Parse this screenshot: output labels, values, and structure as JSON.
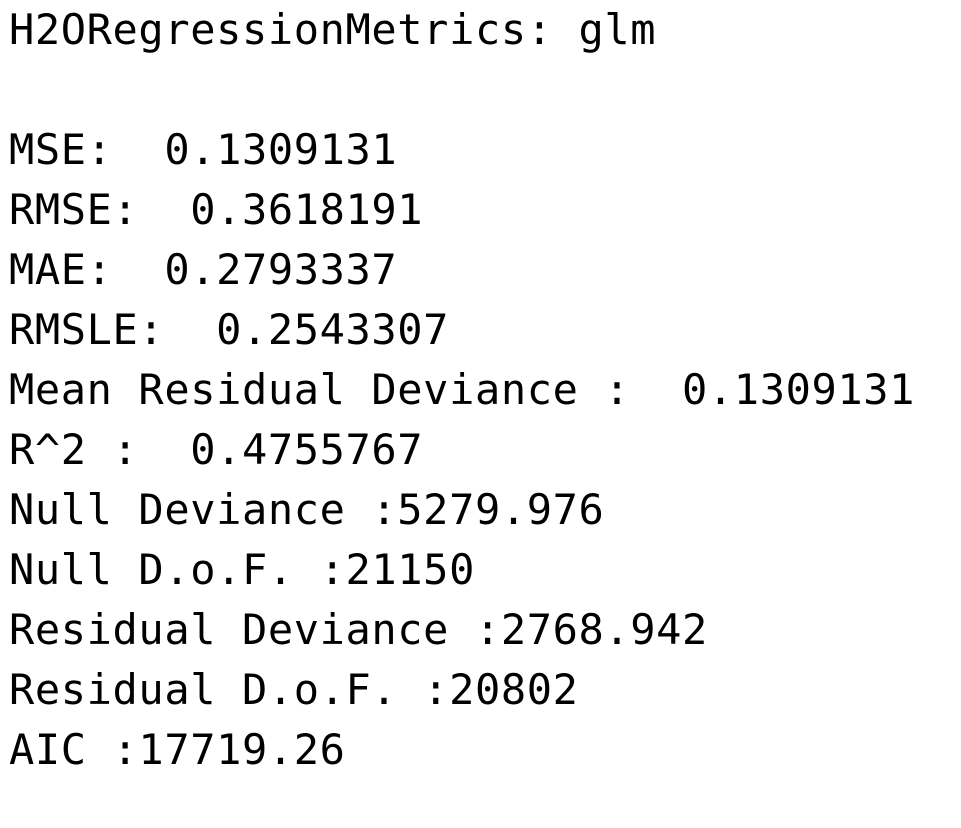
{
  "header": "H2ORegressionMetrics: glm",
  "metrics": [
    "MSE:  0.1309131",
    "RMSE:  0.3618191",
    "MAE:  0.2793337",
    "RMSLE:  0.2543307",
    "Mean Residual Deviance :  0.1309131",
    "R^2 :  0.4755767",
    "Null Deviance :5279.976",
    "Null D.o.F. :21150",
    "Residual Deviance :2768.942",
    "Residual D.o.F. :20802",
    "AIC :17719.26"
  ]
}
